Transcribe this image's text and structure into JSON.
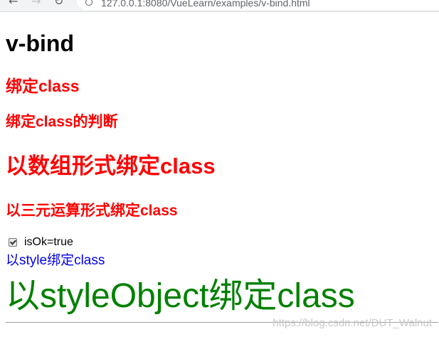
{
  "browser": {
    "url": "127.0.0.1:8080/VueLearn/examples/v-bind.html",
    "back_icon": "←",
    "forward_icon": "→",
    "reload_icon": "↻"
  },
  "page": {
    "title": "v-bind",
    "heading_bind_class": "绑定class",
    "heading_class_judge": "绑定class的判断",
    "heading_array_class": "以数组形式绑定class",
    "heading_ternary_class": "以三元运算形式绑定class",
    "checkbox_label": "isOk=true",
    "checkbox_checked": true,
    "style_bind_text": "以style绑定class",
    "style_object_text": "以styleObject绑定class"
  },
  "watermark": "https://blog.csdn.net/DUT_Walnut",
  "colors": {
    "red": "#ff0000",
    "blue": "#0000ee",
    "green": "#008000"
  }
}
